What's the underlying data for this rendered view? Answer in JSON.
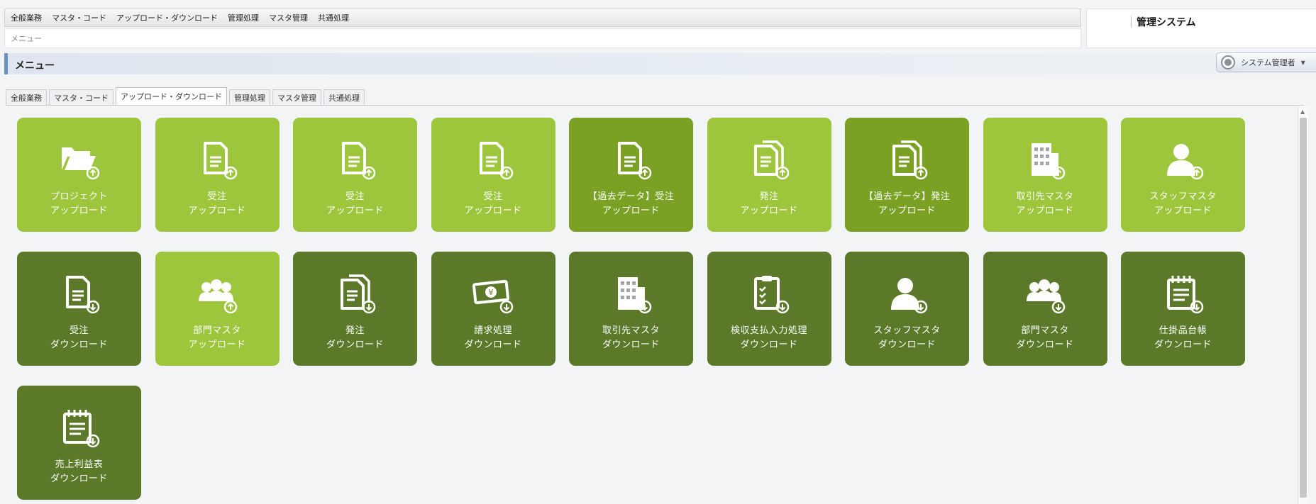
{
  "topbar": {
    "items": [
      "全般業務",
      "マスタ・コード",
      "アップロード・ダウンロード",
      "管理処理",
      "マスタ管理",
      "共通処理"
    ]
  },
  "breadcrumb": "メニュー",
  "system": {
    "title": "管理システム"
  },
  "menubar": {
    "label": "メニュー"
  },
  "user": {
    "name": "システム管理者"
  },
  "tabs": [
    "全般業務",
    "マスタ・コード",
    "アップロード・ダウンロード",
    "管理処理",
    "マスタ管理",
    "共通処理"
  ],
  "active_tab": "アップロード・ダウンロード",
  "colors": {
    "light": "#9dc63d",
    "mid": "#7aa123",
    "dark": "#5b7929"
  },
  "tiles": [
    {
      "line1": "プロジェクト",
      "line2": "アップロード",
      "icon": "folder-upload-icon",
      "shade": "light"
    },
    {
      "line1": "受注",
      "line2": "アップロード",
      "icon": "document-upload-icon",
      "shade": "light"
    },
    {
      "line1": "受注",
      "line2": "アップロード",
      "icon": "document-upload-icon",
      "shade": "light"
    },
    {
      "line1": "受注",
      "line2": "アップロード",
      "icon": "document-upload-icon",
      "shade": "light"
    },
    {
      "line1": "【過去データ】受注",
      "line2": "アップロード",
      "icon": "document-upload-icon",
      "shade": "mid"
    },
    {
      "line1": "発注",
      "line2": "アップロード",
      "icon": "documents-upload-icon",
      "shade": "light"
    },
    {
      "line1": "【過去データ】発注",
      "line2": "アップロード",
      "icon": "documents-upload-icon",
      "shade": "mid"
    },
    {
      "line1": "取引先マスタ",
      "line2": "アップロード",
      "icon": "building-upload-icon",
      "shade": "light"
    },
    {
      "line1": "スタッフマスタ",
      "line2": "アップロード",
      "icon": "person-upload-icon",
      "shade": "light"
    },
    {
      "line1": "受注",
      "line2": "ダウンロード",
      "icon": "document-download-icon",
      "shade": "dark"
    },
    {
      "line1": "部門マスタ",
      "line2": "アップロード",
      "icon": "group-upload-icon",
      "shade": "light"
    },
    {
      "line1": "発注",
      "line2": "ダウンロード",
      "icon": "documents-download-icon",
      "shade": "dark"
    },
    {
      "line1": "請求処理",
      "line2": "ダウンロード",
      "icon": "money-download-icon",
      "shade": "dark"
    },
    {
      "line1": "取引先マスタ",
      "line2": "ダウンロード",
      "icon": "building-download-icon",
      "shade": "dark"
    },
    {
      "line1": "検収支払入力処理",
      "line2": "ダウンロード",
      "icon": "clipboard-download-icon",
      "shade": "dark"
    },
    {
      "line1": "スタッフマスタ",
      "line2": "ダウンロード",
      "icon": "person-download-icon",
      "shade": "dark"
    },
    {
      "line1": "部門マスタ",
      "line2": "ダウンロード",
      "icon": "group-download-icon",
      "shade": "dark"
    },
    {
      "line1": "仕掛品台帳",
      "line2": "ダウンロード",
      "icon": "notepad-download-icon",
      "shade": "dark"
    },
    {
      "line1": "売上利益表",
      "line2": "ダウンロード",
      "icon": "notepad-download-icon",
      "shade": "dark"
    }
  ]
}
